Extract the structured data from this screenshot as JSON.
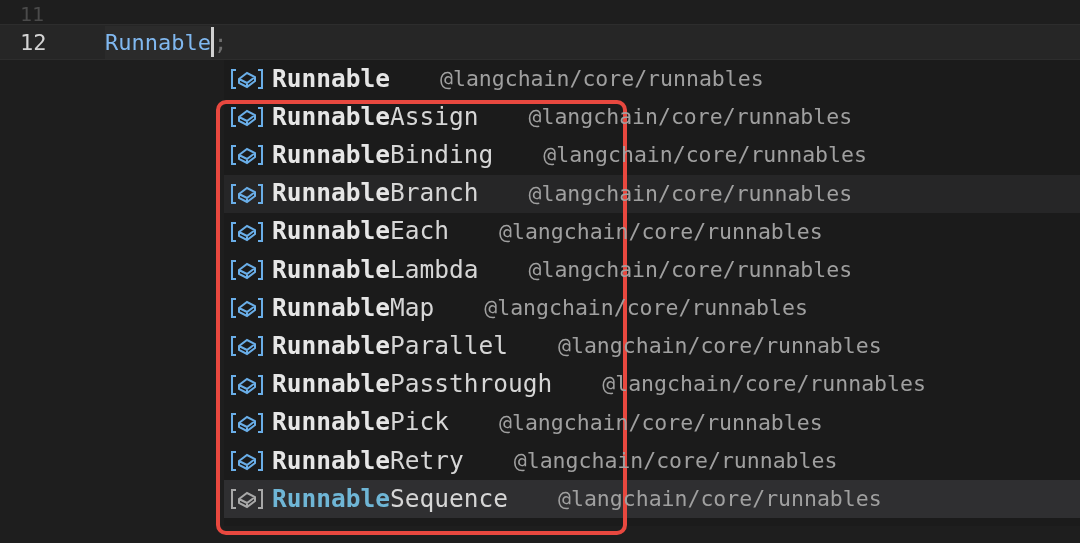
{
  "editor": {
    "lines": [
      {
        "number": "11",
        "current": false
      },
      {
        "number": "12",
        "code": "Runnable",
        "after_cursor": ";",
        "current": true
      }
    ]
  },
  "suggestions": [
    {
      "match": "Runnable",
      "detail": "@langchain/core/runnables",
      "selected": false,
      "hovered": false
    },
    {
      "match": "Runnable",
      "rest": "Assign",
      "detail": "@langchain/core/runnables",
      "selected": false,
      "hovered": false
    },
    {
      "match": "Runnable",
      "rest": "Binding",
      "detail": "@langchain/core/runnables",
      "selected": false,
      "hovered": false
    },
    {
      "match": "Runnable",
      "rest": "Branch",
      "detail": "@langchain/core/runnables",
      "selected": false,
      "hovered": true
    },
    {
      "match": "Runnable",
      "rest": "Each",
      "detail": "@langchain/core/runnables",
      "selected": false,
      "hovered": false
    },
    {
      "match": "Runnable",
      "rest": "Lambda",
      "detail": "@langchain/core/runnables",
      "selected": false,
      "hovered": false
    },
    {
      "match": "Runnable",
      "rest": "Map",
      "detail": "@langchain/core/runnables",
      "selected": false,
      "hovered": false
    },
    {
      "match": "Runnable",
      "rest": "Parallel",
      "detail": "@langchain/core/runnables",
      "selected": false,
      "hovered": false
    },
    {
      "match": "Runnable",
      "rest": "Passthrough",
      "detail": "@langchain/core/runnables",
      "selected": false,
      "hovered": false
    },
    {
      "match": "Runnable",
      "rest": "Pick",
      "detail": "@langchain/core/runnables",
      "selected": false,
      "hovered": false
    },
    {
      "match": "Runnable",
      "rest": "Retry",
      "detail": "@langchain/core/runnables",
      "selected": false,
      "hovered": false
    },
    {
      "match": "Runnable",
      "rest": "Sequence",
      "detail": "@langchain/core/runnables",
      "selected": true,
      "hovered": false
    }
  ],
  "annotation": {
    "kind": "frame",
    "color": "#e8483f"
  }
}
